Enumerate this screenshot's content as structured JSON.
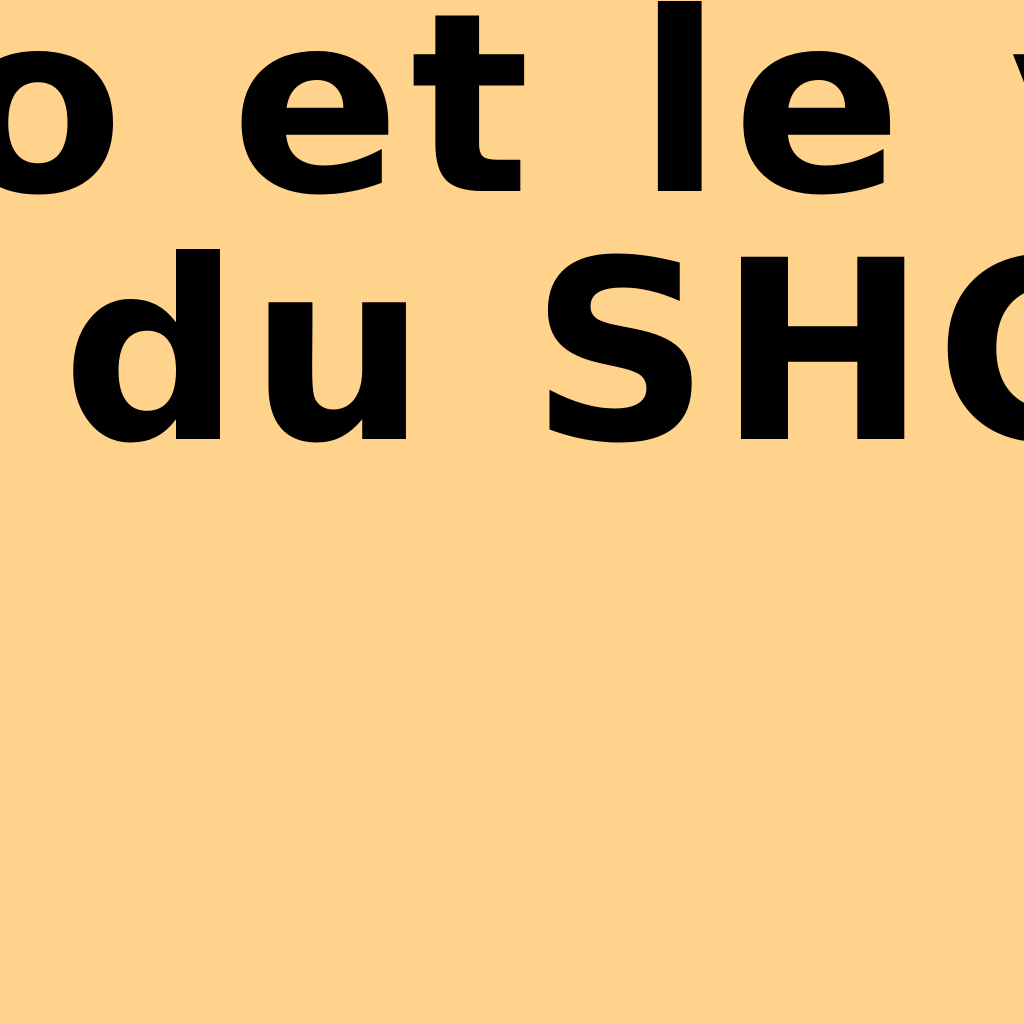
{
  "background_color": "#FFD38C",
  "text_color": "#000000",
  "lines": [
    {
      "text": "o et le ve"
    },
    {
      "text": "du SHC."
    }
  ]
}
